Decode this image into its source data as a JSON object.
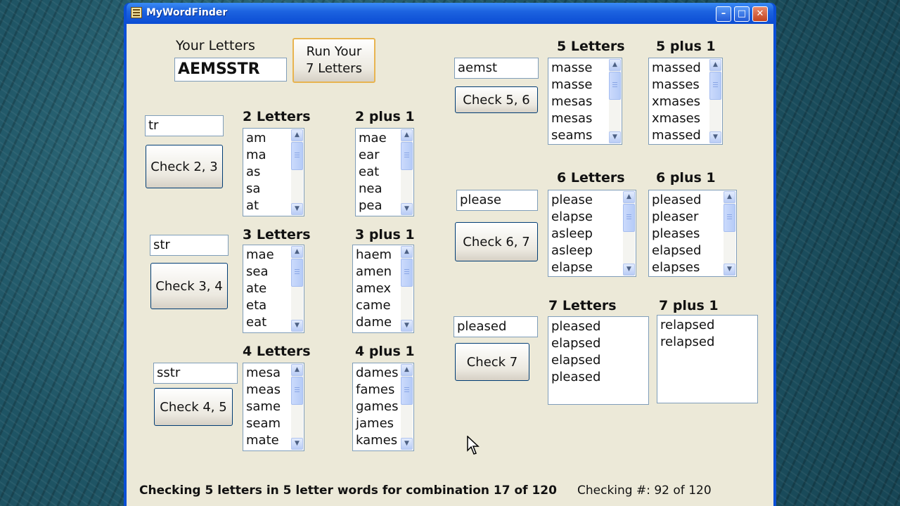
{
  "window": {
    "title": "MyWordFinder"
  },
  "your_letters": {
    "label": "Your Letters",
    "value": "AEMSSTR",
    "run_label": "Run Your\n7 Letters"
  },
  "groups": {
    "g23": {
      "input": "tr",
      "button": "Check 2, 3",
      "h1": "2 Letters",
      "l1": [
        "am",
        "ma",
        "as",
        "sa",
        "at"
      ],
      "h2": "2 plus 1",
      "l2": [
        "mae",
        "ear",
        "eat",
        "nea",
        "pea"
      ]
    },
    "g34": {
      "input": "str",
      "button": "Check 3, 4",
      "h1": "3 Letters",
      "l1": [
        "mae",
        "sea",
        "ate",
        "eta",
        "eat"
      ],
      "h2": "3 plus 1",
      "l2": [
        "haem",
        "amen",
        "amex",
        "came",
        "dame"
      ]
    },
    "g45": {
      "input": "sstr",
      "button": "Check 4, 5",
      "h1": "4 Letters",
      "l1": [
        "mesa",
        "meas",
        "same",
        "seam",
        "mate"
      ],
      "h2": "4 plus 1",
      "l2": [
        "dames",
        "fames",
        "games",
        "james",
        "kames"
      ]
    },
    "g56": {
      "input": "aemst",
      "button": "Check 5, 6",
      "h1": "5 Letters",
      "l1": [
        "masse",
        "masse",
        "mesas",
        "mesas",
        "seams"
      ],
      "h2": "5 plus 1",
      "l2": [
        "massed",
        "masses",
        "xmases",
        "xmases",
        "massed"
      ]
    },
    "g67": {
      "input": "please",
      "button": "Check 6, 7",
      "h1": "6 Letters",
      "l1": [
        "please",
        "elapse",
        "asleep",
        "asleep",
        "elapse"
      ],
      "h2": "6 plus 1",
      "l2": [
        "pleased",
        "pleaser",
        "pleases",
        "elapsed",
        "elapses"
      ]
    },
    "g7": {
      "input": "pleased",
      "button": "Check 7",
      "h1": "7 Letters",
      "l1": [
        "pleased",
        "elapsed",
        "elapsed",
        "pleased"
      ],
      "h2": "7 plus 1",
      "l2": [
        "relapsed",
        "relapsed"
      ]
    }
  },
  "status": {
    "left": "Checking 5 letters in 5 letter words for combination 17 of 120",
    "right": "Checking #: 92 of 120"
  },
  "icons": {
    "scroll_up": "scroll-up-arrow-icon",
    "scroll_down": "scroll-down-arrow-icon",
    "cursor": "mouse-pointer-icon"
  }
}
